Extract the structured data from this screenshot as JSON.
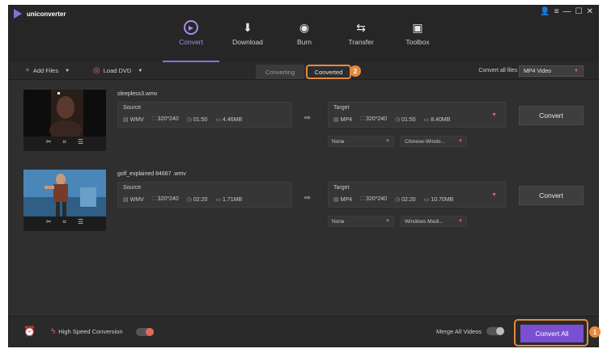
{
  "app": {
    "title": "uniconverter"
  },
  "window_controls": [
    "👤",
    "≡",
    "—",
    "☐",
    "✕"
  ],
  "nav": [
    {
      "label": "Convert",
      "icon": "convert-icon",
      "glyph": "▶",
      "active": true
    },
    {
      "label": "Download",
      "icon": "download-icon",
      "glyph": "⬇",
      "active": false
    },
    {
      "label": "Burn",
      "icon": "burn-icon",
      "glyph": "◉",
      "active": false
    },
    {
      "label": "Transfer",
      "icon": "transfer-icon",
      "glyph": "⇆",
      "active": false
    },
    {
      "label": "Toolbox",
      "icon": "toolbox-icon",
      "glyph": "▣",
      "active": false
    }
  ],
  "toolbar": {
    "add_files": "Add Files",
    "load_dvd": "Load DVD",
    "tab_converting": "Converting",
    "tab_converted": "Converted",
    "converted_badge": "2",
    "convert_all_to_label": "Convert all files to:",
    "format": "MP4 Video"
  },
  "items": [
    {
      "filename": "sleepless3.wmv",
      "source": {
        "label": "Source",
        "format": "WMV",
        "resolution": "320*240",
        "duration": "01:50",
        "size": "4.46MB"
      },
      "target": {
        "label": "Target",
        "format": "MP4",
        "resolution": "320*240",
        "duration": "01:50",
        "size": "8.40MB"
      },
      "subtitle": "None",
      "audio": "Chinese-Windo...",
      "convert_label": "Convert"
    },
    {
      "filename": "golf_explained 84687 .wmv",
      "source": {
        "label": "Source",
        "format": "WMV",
        "resolution": "320*240",
        "duration": "02:20",
        "size": "1.71MB"
      },
      "target": {
        "label": "Target",
        "format": "MP4",
        "resolution": "320*240",
        "duration": "02:20",
        "size": "10.70MB"
      },
      "subtitle": "None",
      "audio": "Windows Medi...",
      "convert_label": "Convert"
    }
  ],
  "bottom": {
    "high_speed_label": "High Speed Conversion",
    "merge_label": "Merge All Videos",
    "convert_all_label": "Convert All",
    "convert_all_badge": "1"
  },
  "colors": {
    "accent": "#7a4fd0",
    "highlight": "#e58a3c",
    "icon_red": "#e06a5a"
  }
}
